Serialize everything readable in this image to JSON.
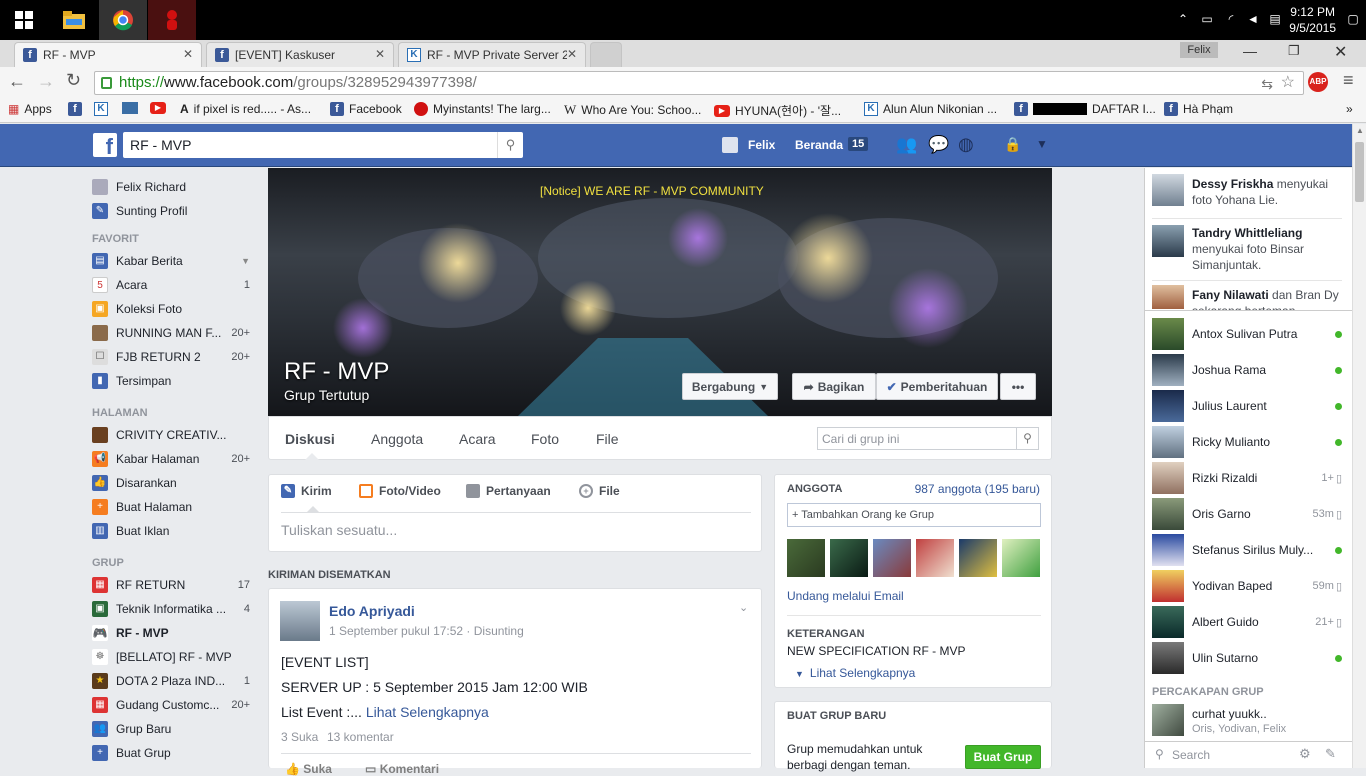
{
  "taskbar": {
    "time": "9:12 PM",
    "date": "9/5/2015"
  },
  "browser": {
    "tabs": [
      {
        "label": "RF - MVP",
        "active": true
      },
      {
        "label": "[EVENT] Kaskuser",
        "active": false
      },
      {
        "label": "RF - MVP Private Server 2…",
        "active": false
      }
    ],
    "user_badge": "Felix",
    "url_scheme": "https://",
    "url_host": "www.facebook.com",
    "url_path": "/groups/328952943977398/",
    "bookmarks": [
      {
        "label": "Apps",
        "icon": "apps-grid-icon"
      },
      {
        "label": "",
        "icon": "facebook-icon"
      },
      {
        "label": "",
        "icon": "kaskus-icon"
      },
      {
        "label": "",
        "icon": "bookmark-icon"
      },
      {
        "label": "",
        "icon": "youtube-icon"
      },
      {
        "label": "if pixel is red..... - As...",
        "icon": "ask-icon"
      },
      {
        "label": "Facebook",
        "icon": "facebook-icon"
      },
      {
        "label": "Myinstants! The larg...",
        "icon": "red-button-icon"
      },
      {
        "label": "Who Are You: Schoo...",
        "icon": "wikipedia-icon"
      },
      {
        "label": "HYUNA(현아) - '잘...",
        "icon": "youtube-icon"
      },
      {
        "label": "Alun Alun Nikonian ...",
        "icon": "kaskus-icon"
      },
      {
        "label": "DAFTAR I...",
        "icon": "facebook-icon"
      },
      {
        "label": "Hà Phạm",
        "icon": "facebook-icon"
      }
    ]
  },
  "fb_header": {
    "search_value": "RF - MVP",
    "user_name": "Felix",
    "home_label": "Beranda",
    "home_count": "15"
  },
  "left_nav": {
    "profile": [
      {
        "label": "Felix Richard",
        "icon": "profile-icon",
        "count": ""
      },
      {
        "label": "Sunting Profil",
        "icon": "edit-icon",
        "count": ""
      }
    ],
    "favorites_header": "FAVORIT",
    "favorites": [
      {
        "label": "Kabar Berita",
        "icon": "news-feed-icon",
        "count": ""
      },
      {
        "label": "Acara",
        "icon": "calendar-icon",
        "count": "1"
      },
      {
        "label": "Koleksi Foto",
        "icon": "photos-icon",
        "count": ""
      },
      {
        "label": "RUNNING MAN F...",
        "icon": "group-icon",
        "count": "20+"
      },
      {
        "label": "FJB RETURN 2",
        "icon": "group-icon",
        "count": "20+"
      },
      {
        "label": "Tersimpan",
        "icon": "saved-icon",
        "count": ""
      }
    ],
    "pages_header": "HALAMAN",
    "pages": [
      {
        "label": "CRIVITY CREATIV...",
        "icon": "page-icon",
        "count": ""
      },
      {
        "label": "Kabar Halaman",
        "icon": "megaphone-icon",
        "count": "20+"
      },
      {
        "label": "Disarankan",
        "icon": "like-icon",
        "count": ""
      },
      {
        "label": "Buat Halaman",
        "icon": "create-page-icon",
        "count": ""
      },
      {
        "label": "Buat Iklan",
        "icon": "ads-icon",
        "count": ""
      }
    ],
    "groups_header": "GRUP",
    "groups": [
      {
        "label": "RF RETURN",
        "icon": "gift-icon",
        "count": "17"
      },
      {
        "label": "Teknik Informatika ...",
        "icon": "group-icon",
        "count": "4"
      },
      {
        "label": "RF - MVP",
        "icon": "gamepad-icon",
        "count": ""
      },
      {
        "label": "[BELLATO] RF - MVP",
        "icon": "group-icon",
        "count": ""
      },
      {
        "label": "DOTA 2 Plaza IND...",
        "icon": "star-icon",
        "count": "1"
      },
      {
        "label": "Gudang Customc...",
        "icon": "gift-icon",
        "count": "20+"
      },
      {
        "label": "Grup Baru",
        "icon": "people-icon",
        "count": ""
      },
      {
        "label": "Buat Grup",
        "icon": "plus-icon",
        "count": ""
      }
    ]
  },
  "cover": {
    "notice": "[Notice] WE ARE RF - MVP COMMUNITY",
    "group_name": "RF - MVP",
    "group_type": "Grup Tertutup",
    "btn_join": "Bergabung",
    "btn_share": "Bagikan",
    "btn_notify": "Pemberitahuan",
    "btn_more": "•••"
  },
  "group_tabs": [
    "Diskusi",
    "Anggota",
    "Acara",
    "Foto",
    "File"
  ],
  "group_search_placeholder": "Cari di grup ini",
  "composer": {
    "tabs": [
      "Kirim",
      "Foto/Video",
      "Pertanyaan",
      "File"
    ],
    "placeholder": "Tuliskan sesuatu..."
  },
  "pinned_header": "KIRIMAN DISEMATKAN",
  "post": {
    "author": "Edo Apriyadi",
    "meta": "1 September pukul 17:52 · Disunting",
    "line1": "[EVENT LIST]",
    "line2": "SERVER UP : 5 September 2015 Jam 12:00 WIB",
    "line3_prefix": "List Event :... ",
    "line3_link": "Lihat Selengkapnya",
    "likes": "3 Suka",
    "comments": "13 komentar",
    "action_like": "Suka",
    "action_comment": "Komentari"
  },
  "members_card": {
    "header": "ANGGOTA",
    "count": "987 anggota (195 baru)",
    "add_label": "+ Tambahkan Orang ke Grup",
    "invite_email": "Undang melalui Email",
    "desc_header": "KETERANGAN",
    "desc_text": "NEW SPECIFICATION RF - MVP",
    "see_more": "Lihat Selengkapnya"
  },
  "create_group_card": {
    "header": "BUAT GRUP BARU",
    "text": "Grup memudahkan untuk berbagi dengan teman.",
    "button": "Buat Grup"
  },
  "ticker": [
    {
      "actor": "Dessy Friskha",
      "rest": " menyukai foto Yohana Lie."
    },
    {
      "actor": "Tandry Whittleliang",
      "rest": " menyukai foto Binsar Simanjuntak."
    },
    {
      "actor": "Fany Nilawati",
      "rest": " dan Bran Dy sekarang berteman."
    }
  ],
  "chat": [
    {
      "name": "Antox Sulivan Putra",
      "status": "online",
      "time": ""
    },
    {
      "name": "Joshua Rama",
      "status": "online",
      "time": ""
    },
    {
      "name": "Julius Laurent",
      "status": "online",
      "time": ""
    },
    {
      "name": "Ricky Mulianto",
      "status": "online",
      "time": ""
    },
    {
      "name": "Rizki Rizaldi",
      "status": "mobile",
      "time": "1+"
    },
    {
      "name": "Oris Garno",
      "status": "mobile",
      "time": "53m"
    },
    {
      "name": "Stefanus Sirilus Muly...",
      "status": "online",
      "time": ""
    },
    {
      "name": "Yodivan Baped",
      "status": "mobile",
      "time": "59m"
    },
    {
      "name": "Albert Guido",
      "status": "mobile",
      "time": "21+"
    },
    {
      "name": "Ulin Sutarno",
      "status": "online",
      "time": ""
    }
  ],
  "group_chats_header": "PERCAKAPAN GRUP",
  "group_chat": {
    "name": "curhat yuukk..",
    "members": "Oris, Yodivan, Felix"
  },
  "chat_search_placeholder": "Search"
}
